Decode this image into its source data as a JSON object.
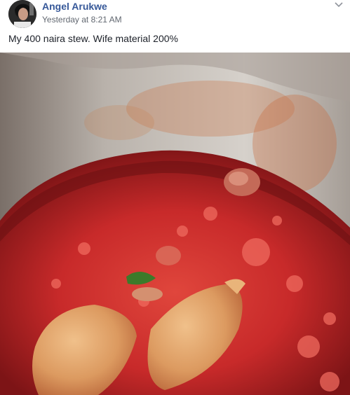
{
  "post": {
    "author": {
      "name": "Angel Arukwe"
    },
    "timestamp": "Yesterday at 8:21 AM",
    "text": "My 400 naira stew. Wife material 200%",
    "options_icon": "chevron-down-icon"
  },
  "photo": {
    "subject_icon": "photo-stew-pot",
    "colors": {
      "pot_rim": "#c9c4be",
      "stew_red": "#c8282a",
      "chicken": "#e0a070",
      "link": "#365899"
    }
  }
}
